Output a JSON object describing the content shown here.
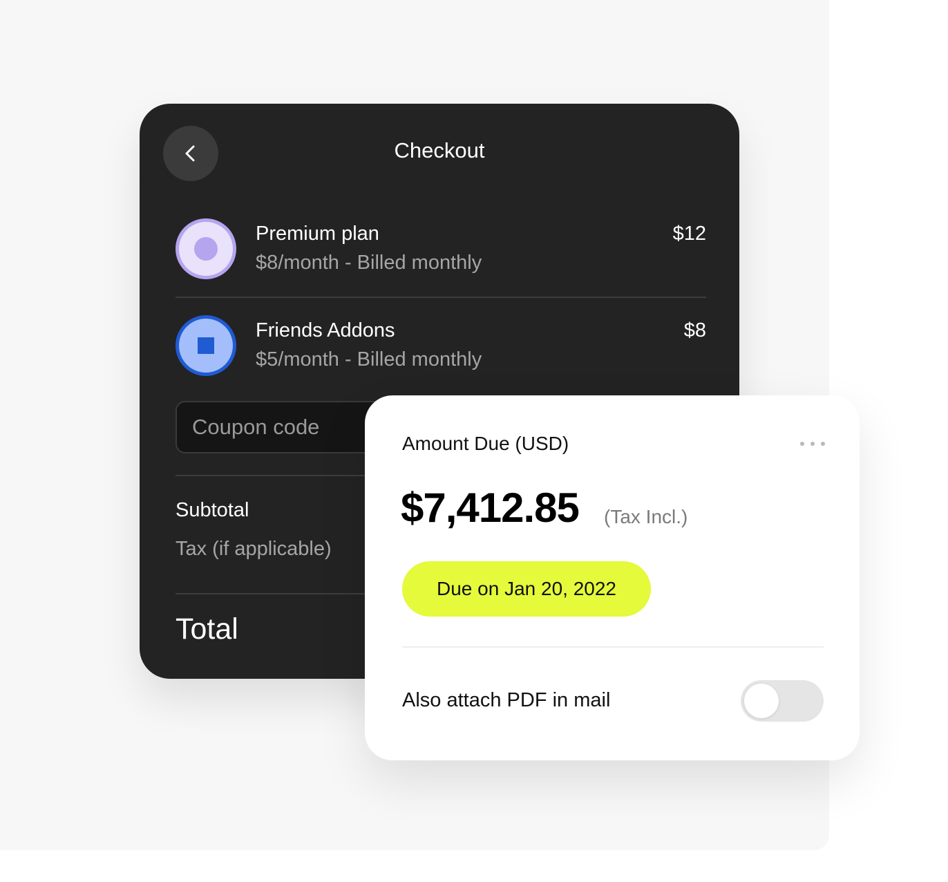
{
  "checkout": {
    "title": "Checkout",
    "back_icon": "chevron-left-icon",
    "items": [
      {
        "name": "Premium plan",
        "description": "$8/month - Billed monthly",
        "price": "$12",
        "icon": "radio-circle-icon",
        "icon_colors": {
          "fill": "#e9e2fb",
          "accent": "#b5a4ee"
        }
      },
      {
        "name": "Friends Addons",
        "description": "$5/month - Billed monthly",
        "price": "$8",
        "icon": "square-in-circle-icon",
        "icon_colors": {
          "fill": "#a3befa",
          "accent": "#1f5bd3"
        }
      }
    ],
    "coupon_placeholder": "Coupon code",
    "subtotal_label": "Subtotal",
    "tax_label": "Tax (if applicable)",
    "total_label": "Total"
  },
  "amount_due": {
    "label": "Amount Due (USD)",
    "value": "$7,412.85",
    "tax_note": "(Tax Incl.)",
    "due_label": "Due on Jan 20, 2022",
    "attach_label": "Also attach PDF in mail",
    "attach_pdf_enabled": false,
    "more_icon": "more-horizontal-icon"
  },
  "colors": {
    "card_dark": "#232323",
    "due_pill": "#e4fa3b",
    "backdrop": "#f7f7f7"
  }
}
